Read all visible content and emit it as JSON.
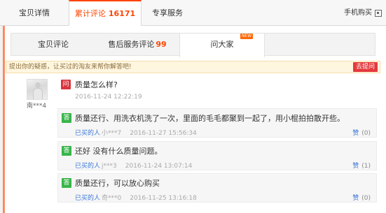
{
  "top_tabs": {
    "item_detail": "宝贝详情",
    "reviews_label": "累计评论",
    "reviews_count": "16171",
    "exclusive": "专享服务",
    "mobile_buy": "手机购买"
  },
  "sub_tabs": {
    "item_reviews": "宝贝评论",
    "after_sale_label": "售后服务评论",
    "after_sale_count": "99",
    "ask_all": "问大家",
    "new_badge": "NEW"
  },
  "prompt": {
    "text": "提出你的疑惑，让买过的淘友来帮你解答吧!",
    "ask_button": "去提问"
  },
  "question": {
    "user": "南***4",
    "icon": "问",
    "text": "质量怎么样?",
    "time": "2016-11-24 12:22:19"
  },
  "answers": [
    {
      "icon": "答",
      "text": "质量还行、用洗衣机洗了一次，里面的毛毛都聚到一起了，用小棍拍拍散开些。",
      "buyer_label": "已买的人",
      "buyer": "小***7",
      "time": "2016-11-27 15:56:34",
      "like_label": "赞",
      "likes": "(0)"
    },
    {
      "icon": "答",
      "text": "还好 没有什么质量问题。",
      "buyer_label": "已买的人",
      "buyer": "j***3",
      "time": "2016-11-24 13:07:14",
      "like_label": "赞",
      "likes": "(1)"
    },
    {
      "icon": "答",
      "text": "质量还行，可以放心购买",
      "buyer_label": "已买的人",
      "buyer": "奇***0",
      "time": "2016-11-25 13:16:18",
      "like_label": "赞",
      "likes": "(0)"
    }
  ],
  "colors": {
    "accent": "#ff4400",
    "question_icon": "#d9363e",
    "answer_icon": "#39b54a",
    "link": "#3c78d8"
  }
}
